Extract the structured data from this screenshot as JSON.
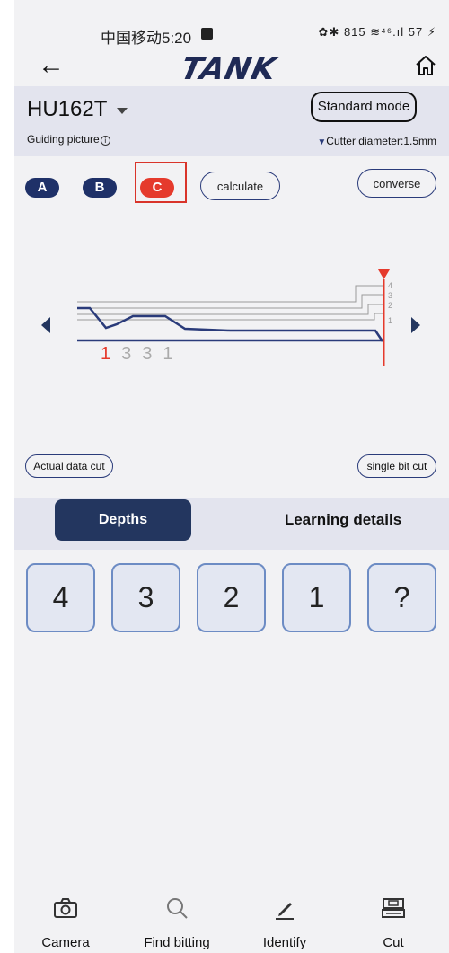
{
  "status_bar": {
    "carrier_time": "中国移动5:20",
    "indicators": "✿✱ 815 ≋⁴⁶.ıl 57 ⚡"
  },
  "nav": {
    "brand": "TANK",
    "back_icon": "arrow-left-icon",
    "home_icon": "home-icon"
  },
  "header": {
    "model": "HU162T",
    "mode_button": "Standard mode",
    "guiding_picture": "Guiding picture",
    "cutter_diameter": "Cutter diameter:1.5mm"
  },
  "tracks": {
    "a": "A",
    "b": "B",
    "c": "C",
    "selected": "C"
  },
  "actions": {
    "calculate": "calculate",
    "converse": "converse",
    "actual_data_cut": "Actual data cut",
    "single_bit_cut": "single bit cut"
  },
  "diagram": {
    "level_labels": [
      "4",
      "3",
      "2",
      "1"
    ],
    "bitting": [
      "1",
      "3",
      "3",
      "1"
    ],
    "colors": {
      "profile": "#2a3b7a",
      "marker": "#e53a2c",
      "guide": "#9a9a9a"
    }
  },
  "tabs": {
    "depths": "Depths",
    "learning": "Learning details",
    "active": "Depths"
  },
  "depth_keys": [
    "4",
    "3",
    "2",
    "1",
    "?"
  ],
  "bottom_nav": {
    "camera": "Camera",
    "find_bitting": "Find bitting",
    "identify": "Identify",
    "cut": "Cut"
  }
}
